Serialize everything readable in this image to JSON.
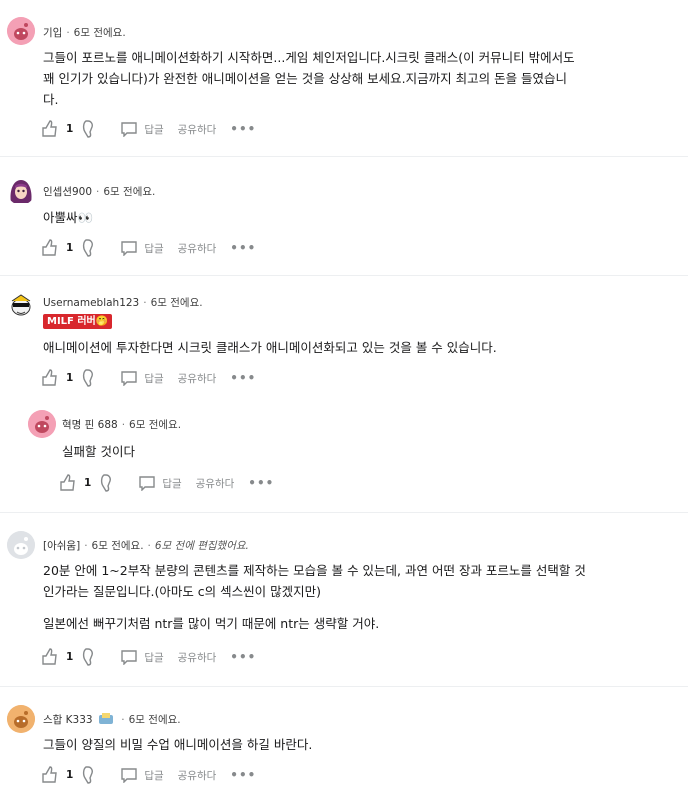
{
  "labels": {
    "reply": "답글",
    "share": "공유하다",
    "more": "•••"
  },
  "comments": [
    {
      "user": "기입",
      "time": "6모 전에요.",
      "lines": [
        "그들이 포르노를 애니메이션화하기 시작하면...게임 체인저입니다.시크릿 클래스(이 커뮤니티 밖에서도",
        "꽤 인기가 있습니다)가 완전한 애니메이션을 얻는 것을 상상해 보세요.지금까지 최고의 돈을 들였습니",
        "다."
      ],
      "votes": "1",
      "avatar": "pink-snoo"
    },
    {
      "user": "인셉션900",
      "time": "6모 전에요.",
      "lines": [
        "아뿔싸👀"
      ],
      "votes": "1",
      "avatar": "purple-hair-girl"
    },
    {
      "user": "Usernameblah123",
      "time": "6모 전에요.",
      "flair": "MILF 러버🤭",
      "lines": [
        "애니메이션에 투자한다면 시크릿 클래스가 애니메이션화되고 있는 것을 볼 수 있습니다."
      ],
      "votes": "1",
      "avatar": "sunglasses-snoo"
    },
    {
      "user": "혁명 핀 688",
      "time": "6모 전에요.",
      "lines": [
        "실패할 것이다"
      ],
      "votes": "1",
      "avatar": "pink-snoo"
    },
    {
      "user": "[아쉬움]",
      "time": "6모 전에요.",
      "edited": "6모 전에 편집했어요.",
      "lines": [
        "20분 안에 1~2부작 분량의 콘텐츠를 제작하는 모습을 볼 수 있는데, 과연 어떤 장과 포르노를 선택할 것",
        "인가라는 질문입니다.(아마도 c의 섹스씬이 많겠지만)"
      ],
      "lines2": [
        "일본에선 뻐꾸기처럼 ntr를 많이 먹기 때문에 ntr는 생략할 거야."
      ],
      "votes": "1",
      "avatar": "grey-snoo"
    },
    {
      "user": "스합 K333",
      "time": "6모 전에요.",
      "lines": [
        "그들이 양질의 비밀 수업 애니메이션을 하길 바란다."
      ],
      "votes": "1",
      "avatar": "orange-snoo"
    }
  ]
}
